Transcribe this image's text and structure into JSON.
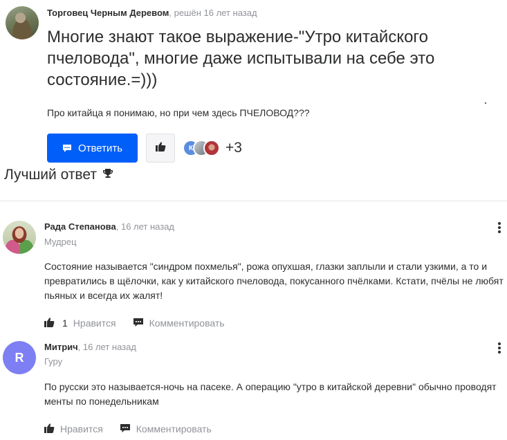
{
  "question": {
    "author": "Торговец Черным Деревом",
    "status": ", решён 16 лет назад",
    "title": "Многие знают такое выражение-\"Утро китайского пчеловода\", многие даже испытывали на себе это состояние.=)))",
    "body": "Про китайца я понимаю, но при чем здесь ПЧЕЛОВОД???",
    "answer_button": "Ответить",
    "liker_initial": "К",
    "likers_more": "+3"
  },
  "best_answer_heading": "Лучший ответ",
  "answers": [
    {
      "author": "Рада Степанова",
      "time": ", 16 лет назад",
      "rank": "Мудрец",
      "text": "Состояние называется \"синдром похмелья\", рожа опухшая, глазки заплыли и стали узкими, а то и превратились в щёлочки, как у китайского пчеловода, покусанного пчёлками. Кстати, пчёлы не любят пьяных и всегда их жалят!",
      "likes": "1",
      "like_label": "Нравится",
      "comment_label": "Комментировать"
    },
    {
      "author": "Митрич",
      "avatar_letter": "R",
      "time": ", 16 лет назад",
      "rank": "Гуру",
      "text": "По русски это называется-ночь на пасеке. А операцию \"утро в китайской деревни\" обычно проводят менты по понедельникам",
      "like_label": "Нравится",
      "comment_label": "Комментировать"
    }
  ],
  "icons": {
    "question_avatar": "user-photo",
    "answer_button_icon": "speech-bubble-icon",
    "like_icon": "thumb-up-icon",
    "trophy_icon": "trophy-icon",
    "more_icon": "vertical-dots-icon",
    "comment_icon": "comment-icon"
  },
  "colors": {
    "primary": "#005ff9",
    "text": "#2c2d2e",
    "muted": "#919399",
    "avatar_letter_bg": "#7e7ff2"
  }
}
